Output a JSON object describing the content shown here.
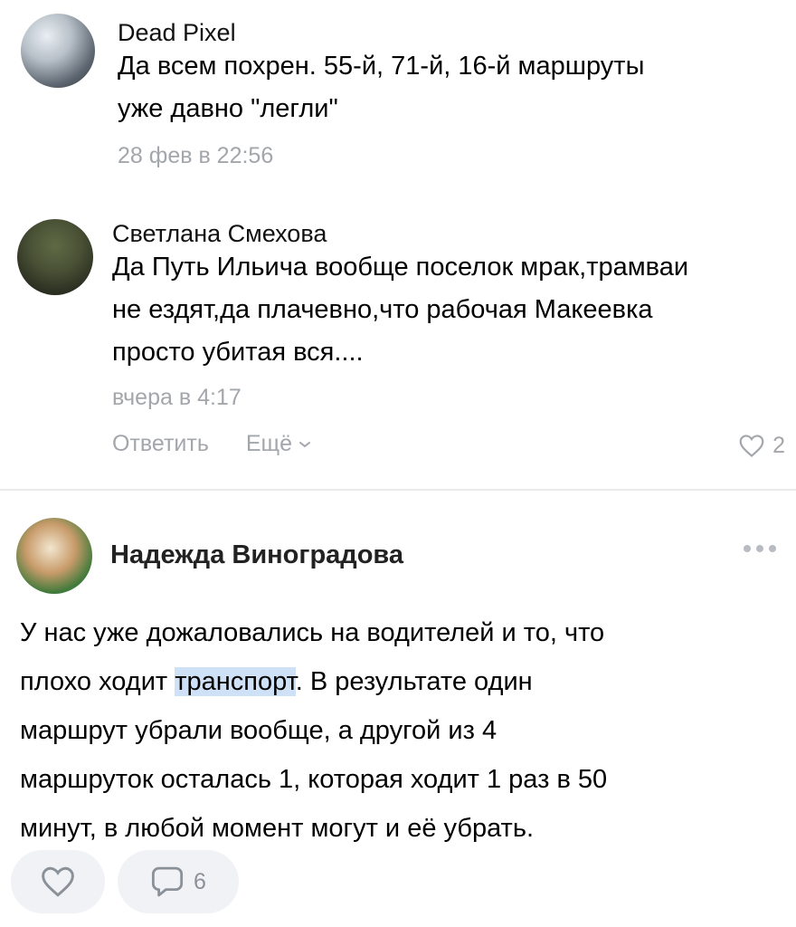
{
  "comments": [
    {
      "author": "Dead Pixel",
      "text_lines": [
        "Да всем похрен. 55-й, 71-й, 16-й маршруты",
        "уже давно \"легли\""
      ],
      "date": "28 фев в 22:56"
    },
    {
      "author": "Светлана Смехова",
      "text_lines": [
        "Да Путь Ильича вообще поселок мрак,трамваи",
        "не ездят,да плачевно,что рабочая Макеевка",
        "просто убитая вся...."
      ],
      "date": "вчера в 4:17",
      "reply_label": "Ответить",
      "more_label": "Ещё",
      "likes": "2"
    },
    {
      "author": "Надежда Виноградова",
      "line1": "У нас уже дожаловались на водителей и то, что",
      "line2_pre": "плохо ходит ",
      "line2_highlight": "транспорт",
      "line2_post": ". В результате один",
      "line3": "маршрут убрали вообще, а другой из 4",
      "line4": "маршруток осталась 1, которая ходит 1 раз в 50",
      "line5": "минут, в любой момент могут и её убрать.",
      "comments_count": "6"
    }
  ],
  "icons": {
    "like": "heart-icon",
    "comment": "comment-bubble-icon",
    "more": "chevron-down-icon",
    "menu": "more-dots-icon"
  },
  "colors": {
    "secondary_text": "#a3a6ab",
    "highlight": "#cfe1f7",
    "pill_bg": "#f0f2f5"
  }
}
